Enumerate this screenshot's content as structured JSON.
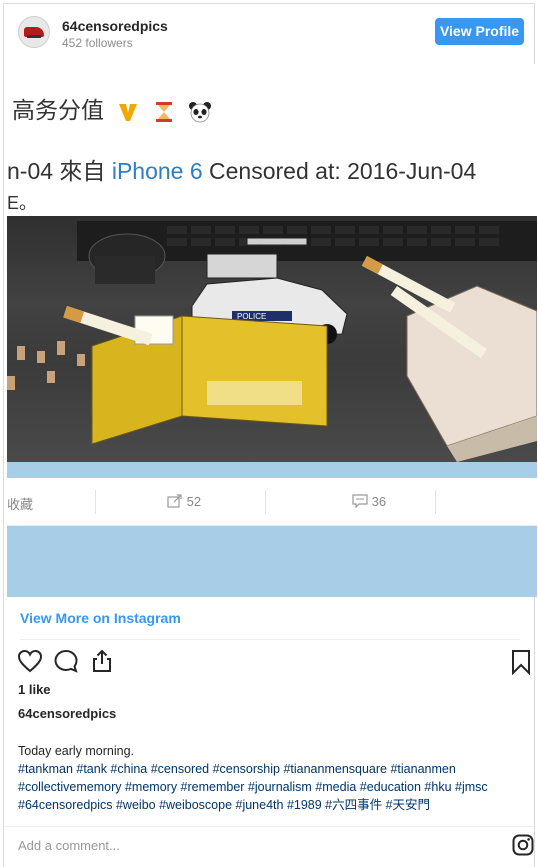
{
  "header": {
    "username": "64censoredpics",
    "followers": "452 followers",
    "view_profile": "View Profile"
  },
  "screenshot": {
    "line1": "高务分值",
    "line2_prefix": "n-04 來自 ",
    "line2_device": "iPhone 6",
    "line2_suffix": " Censored at: 2016-Jun-04",
    "line3": "E。",
    "action_favorite": "收藏",
    "action_share_count": "52",
    "action_comment_count": "36"
  },
  "links": {
    "view_more": "View More on Instagram"
  },
  "post": {
    "likes": "1 like",
    "owner": "64censoredpics",
    "caption_text": "Today early morning.",
    "hashtags": "#tankman #tank #china #censored #censorship #tiananmensquare #tiananmen #collectivememory #memory #remember #journalism #media #education #hku #jmsc #64censoredpics #weibo #weiboscope #june4th #1989 #六四事件 #天安門"
  },
  "comment": {
    "placeholder": "Add a comment..."
  },
  "colors": {
    "brand_blue": "#3897f0",
    "hashtag": "#003569"
  },
  "icons": [
    "heart-icon",
    "comment-icon",
    "share-icon",
    "bookmark-icon",
    "instagram-icon"
  ]
}
